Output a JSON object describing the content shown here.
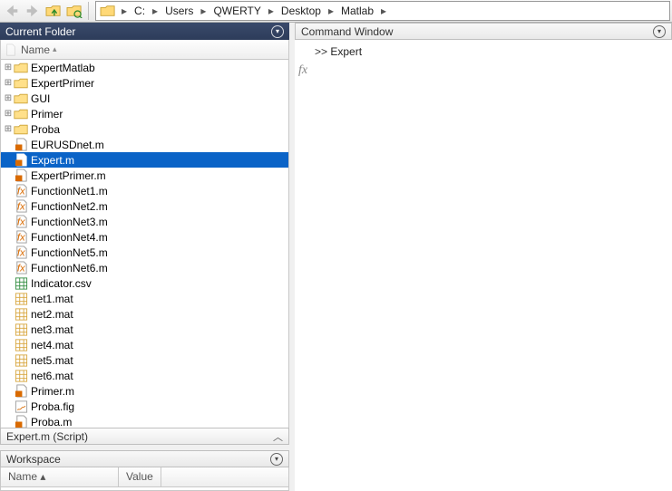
{
  "breadcrumb": [
    "C:",
    "Users",
    "QWERTY",
    "Desktop",
    "Matlab"
  ],
  "panels": {
    "currentFolder": {
      "title": "Current Folder",
      "column": "Name"
    },
    "commandWindow": {
      "title": "Command Window"
    },
    "workspace": {
      "title": "Workspace",
      "columns": [
        "Name",
        "Value"
      ]
    }
  },
  "footer": {
    "text": "Expert.m  (Script)"
  },
  "files": [
    {
      "name": "ExpertMatlab",
      "type": "folder",
      "expandable": true
    },
    {
      "name": "ExpertPrimer",
      "type": "folder",
      "expandable": true
    },
    {
      "name": "GUI",
      "type": "folder",
      "expandable": true
    },
    {
      "name": "Primer",
      "type": "folder",
      "expandable": true
    },
    {
      "name": "Proba",
      "type": "folder",
      "expandable": true
    },
    {
      "name": "EURUSDnet.m",
      "type": "m"
    },
    {
      "name": "Expert.m",
      "type": "m",
      "selected": true
    },
    {
      "name": "ExpertPrimer.m",
      "type": "m"
    },
    {
      "name": "FunctionNet1.m",
      "type": "fx"
    },
    {
      "name": "FunctionNet2.m",
      "type": "fx"
    },
    {
      "name": "FunctionNet3.m",
      "type": "fx"
    },
    {
      "name": "FunctionNet4.m",
      "type": "fx"
    },
    {
      "name": "FunctionNet5.m",
      "type": "fx"
    },
    {
      "name": "FunctionNet6.m",
      "type": "fx"
    },
    {
      "name": "Indicator.csv",
      "type": "csv"
    },
    {
      "name": "net1.mat",
      "type": "mat"
    },
    {
      "name": "net2.mat",
      "type": "mat"
    },
    {
      "name": "net3.mat",
      "type": "mat"
    },
    {
      "name": "net4.mat",
      "type": "mat"
    },
    {
      "name": "net5.mat",
      "type": "mat"
    },
    {
      "name": "net6.mat",
      "type": "mat"
    },
    {
      "name": "Primer.m",
      "type": "m"
    },
    {
      "name": "Proba.fig",
      "type": "fig"
    },
    {
      "name": "Proba.m",
      "type": "m"
    }
  ],
  "command": {
    "prompt": ">>",
    "input": "Expert"
  },
  "icons": {
    "plus": "⊞",
    "sort": "▴",
    "chev_up": "︿",
    "bc_arrow": "▸",
    "circle_arrow": "▾"
  }
}
